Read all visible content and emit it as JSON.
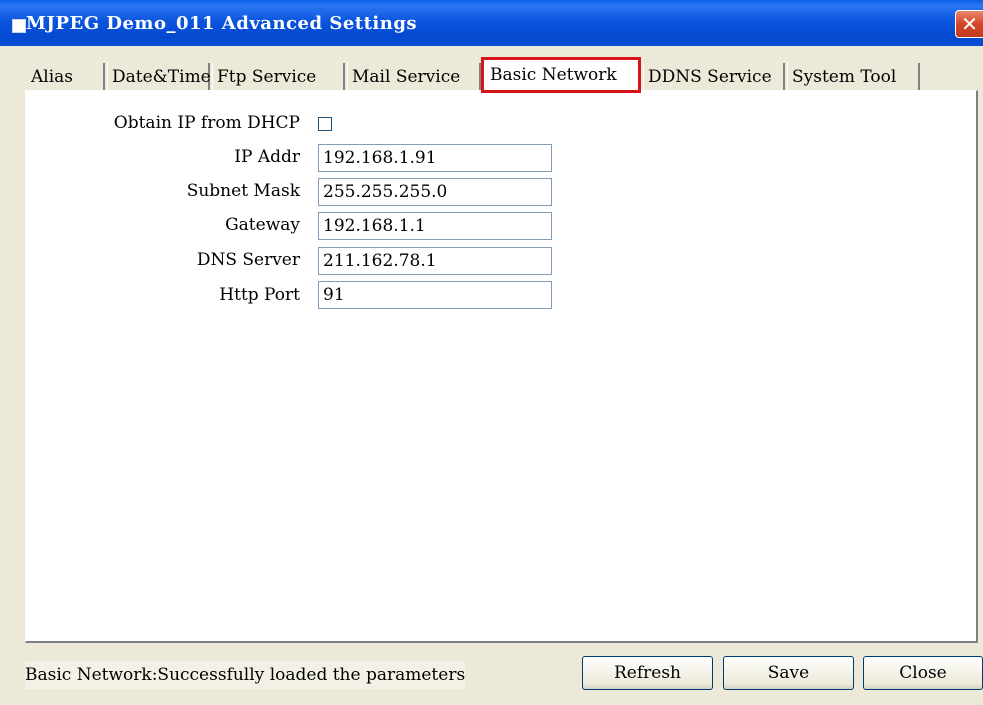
{
  "window": {
    "title": "MJPEG Demo_011 Advanced Settings",
    "close_glyph": "✕"
  },
  "tabs": [
    {
      "label": "Alias"
    },
    {
      "label": "Date&Time"
    },
    {
      "label": "Ftp Service"
    },
    {
      "label": "Mail Service"
    },
    {
      "label": "Basic Network",
      "active": true
    },
    {
      "label": "DDNS Service"
    },
    {
      "label": "System Tool"
    }
  ],
  "form": {
    "dhcp_label": "Obtain IP from DHCP",
    "dhcp_checked": false,
    "ip_label": "IP Addr",
    "ip_value": "192.168.1.91",
    "subnet_label": "Subnet Mask",
    "subnet_value": "255.255.255.0",
    "gateway_label": "Gateway",
    "gateway_value": "192.168.1.1",
    "dns_label": "DNS Server",
    "dns_value": "211.162.78.1",
    "port_label": "Http Port",
    "port_value": "91"
  },
  "status": {
    "message": "Basic Network:Successfully loaded the parameters"
  },
  "buttons": {
    "refresh": "Refresh",
    "save": "Save",
    "close": "Close"
  },
  "colors": {
    "titlebar": "#0b55df",
    "highlight": "#d8141b",
    "dialog_bg": "#ece9d8"
  }
}
